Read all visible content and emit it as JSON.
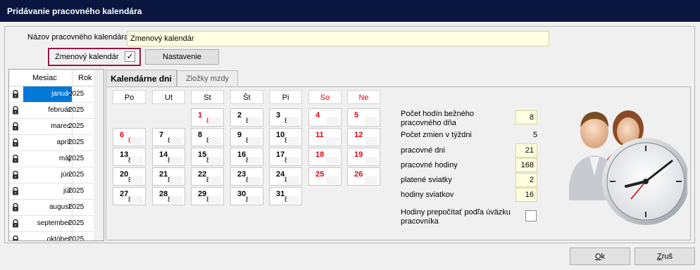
{
  "window": {
    "title": "Pridávanie pracovného kalendára"
  },
  "form": {
    "name_label": "Názov pracovného kalendára",
    "name_value": "Zmenový kalendár",
    "shift_label": "Zmenový kalendár",
    "shift_checked_glyph": "✓",
    "settings_button": "Nastavenie"
  },
  "months": {
    "col_month": "Mesiac",
    "col_year": "Rok",
    "rows": [
      {
        "month": "január",
        "year": "2025"
      },
      {
        "month": "február",
        "year": "2025"
      },
      {
        "month": "marec",
        "year": "2025"
      },
      {
        "month": "apríl",
        "year": "2025"
      },
      {
        "month": "máj",
        "year": "2025"
      },
      {
        "month": "jún",
        "year": "2025"
      },
      {
        "month": "júl",
        "year": "2025"
      },
      {
        "month": "august",
        "year": "2025"
      },
      {
        "month": "september",
        "year": "2025"
      },
      {
        "month": "október",
        "year": "2025"
      }
    ]
  },
  "tabs": {
    "calendar_days": "Kalendárne dni",
    "wage_components": "Zložky mzdy"
  },
  "calendar": {
    "weekdays": [
      "Po",
      "Ut",
      "St",
      "Št",
      "Pi",
      "So",
      "Ne"
    ],
    "weekday_red": [
      false,
      false,
      false,
      false,
      false,
      true,
      true
    ],
    "days": [
      {
        "d": "1",
        "h": "8",
        "red": true
      },
      {
        "d": "2",
        "h": "8",
        "red": false
      },
      {
        "d": "3",
        "h": "8",
        "red": false
      },
      {
        "d": "4",
        "h": "",
        "red": true
      },
      {
        "d": "5",
        "h": "",
        "red": true
      },
      {
        "d": "6",
        "h": "8",
        "red": true
      },
      {
        "d": "7",
        "h": "8",
        "red": false
      },
      {
        "d": "8",
        "h": "8",
        "red": false
      },
      {
        "d": "9",
        "h": "8",
        "red": false
      },
      {
        "d": "10",
        "h": "8",
        "red": false
      },
      {
        "d": "11",
        "h": "",
        "red": true
      },
      {
        "d": "12",
        "h": "",
        "red": true
      },
      {
        "d": "13",
        "h": "8",
        "red": false
      },
      {
        "d": "14",
        "h": "8",
        "red": false
      },
      {
        "d": "15",
        "h": "8",
        "red": false
      },
      {
        "d": "16",
        "h": "8",
        "red": false
      },
      {
        "d": "17",
        "h": "8",
        "red": false
      },
      {
        "d": "18",
        "h": "",
        "red": true
      },
      {
        "d": "19",
        "h": "",
        "red": true
      },
      {
        "d": "20",
        "h": "8",
        "red": false
      },
      {
        "d": "21",
        "h": "8",
        "red": false
      },
      {
        "d": "22",
        "h": "8",
        "red": false
      },
      {
        "d": "23",
        "h": "8",
        "red": false
      },
      {
        "d": "24",
        "h": "8",
        "red": false
      },
      {
        "d": "25",
        "h": "",
        "red": true
      },
      {
        "d": "26",
        "h": "",
        "red": true
      },
      {
        "d": "27",
        "h": "8",
        "red": false
      },
      {
        "d": "28",
        "h": "8",
        "red": false
      },
      {
        "d": "29",
        "h": "8",
        "red": false
      },
      {
        "d": "30",
        "h": "8",
        "red": false
      },
      {
        "d": "31",
        "h": "8",
        "red": false
      }
    ]
  },
  "stats": {
    "daily_hours_label_1": "Počet hodín bežného",
    "daily_hours_label_2": "pracovného dňa",
    "daily_hours": "8",
    "shifts_label": "Počet zmien v týždni",
    "shifts": "5",
    "work_days_label": "pracovné dni",
    "work_days": "21",
    "work_hours_label": "pracovné hodiny",
    "work_hours": "168",
    "paid_holidays_label": "platené sviatky",
    "paid_holidays": "2",
    "holiday_hours_label": "hodiny sviatkov",
    "holiday_hours": "16",
    "recalc_label_1": "Hodiny prepočítať podľa úväzku",
    "recalc_label_2": "pracovníka"
  },
  "footer": {
    "ok_first": "O",
    "ok_rest": "k",
    "cancel_first": "Z",
    "cancel_rest": "ruš"
  },
  "colors": {
    "title_bg": "#0a1640",
    "highlight": "#93184a",
    "holiday": "#e8000b",
    "selection": "#0078d7"
  }
}
